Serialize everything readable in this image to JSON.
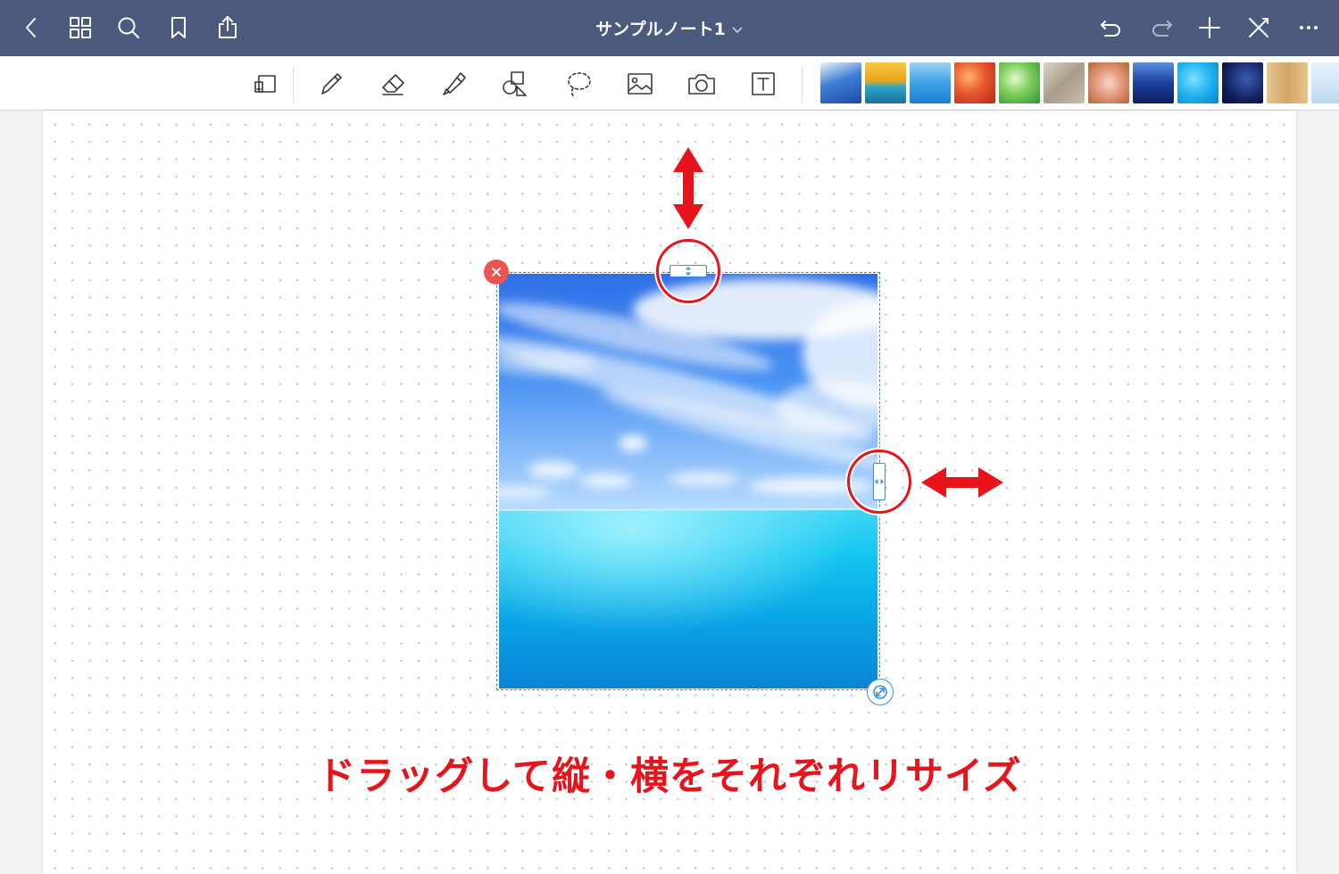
{
  "topbar": {
    "title": "サンプルノート1",
    "background": "#4c5a7d",
    "left_icons": [
      "back-chevron-icon",
      "grid-icon",
      "search-icon",
      "bookmark-icon",
      "share-icon"
    ],
    "right_icons": [
      "undo-icon",
      "redo-icon",
      "plus-icon",
      "close-x-icon",
      "more-dots-icon"
    ]
  },
  "toolbar": {
    "tools": [
      "page-mode-icon",
      "pen-icon",
      "eraser-icon",
      "highlighter-icon",
      "shapes-icon",
      "lasso-icon",
      "image-icon",
      "camera-icon",
      "text-box-icon"
    ],
    "stickers": [
      "sticker-sky-sea",
      "sticker-sunset-beach",
      "sticker-blue-sky",
      "sticker-autumn-leaves",
      "sticker-green-leaves",
      "sticker-stone",
      "sticker-cherry-blossom",
      "sticker-night-lake",
      "sticker-water",
      "sticker-night-sky",
      "sticker-wood",
      "sticker-winter"
    ]
  },
  "canvas": {
    "image": "sky-and-ocean-photo",
    "selection_color": "#3b8ee6",
    "delete_color": "#ef5350"
  },
  "annotation": {
    "caption": "ドラッグして縦・横をそれぞれリサイズ",
    "color": "#e8141c"
  }
}
